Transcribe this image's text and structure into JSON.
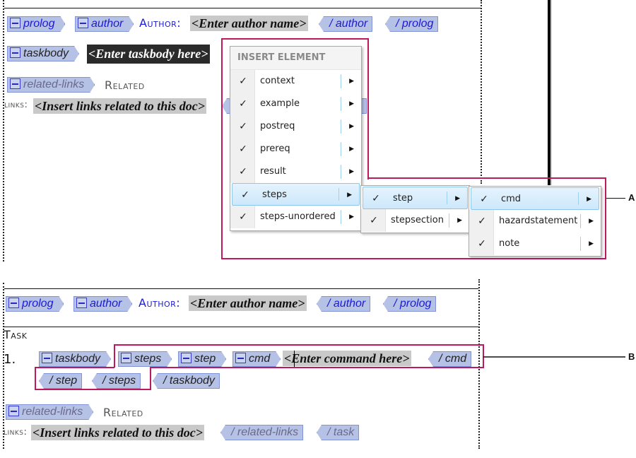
{
  "top_panel": {
    "row1": {
      "prolog_open": "prolog",
      "author_open": "author",
      "author_label": "Author:",
      "author_placeholder": "<Enter author name>",
      "author_close": "/ author",
      "prolog_close": "/ prolog"
    },
    "row2": {
      "taskbody_open": "taskbody",
      "taskbody_placeholder": "<Enter taskbody here>"
    },
    "row3": {
      "related_links_open": "related-links",
      "related_label_1": "Related",
      "related_label_2": "links:",
      "related_placeholder": "<Insert links related to this doc>"
    }
  },
  "insert_menu": {
    "title": "INSERT ELEMENT",
    "items": [
      {
        "label": "context",
        "checked": true,
        "has_submenu": true
      },
      {
        "label": "example",
        "checked": true,
        "has_submenu": true
      },
      {
        "label": "postreq",
        "checked": true,
        "has_submenu": true
      },
      {
        "label": "prereq",
        "checked": true,
        "has_submenu": true
      },
      {
        "label": "result",
        "checked": true,
        "has_submenu": true
      },
      {
        "label": "steps",
        "checked": true,
        "has_submenu": true,
        "highlighted": true
      },
      {
        "label": "steps-unordered",
        "checked": true,
        "has_submenu": true
      }
    ],
    "submenu_steps": [
      {
        "label": "step",
        "checked": true,
        "has_submenu": true,
        "highlighted": true
      },
      {
        "label": "stepsection",
        "checked": true,
        "has_submenu": true
      }
    ],
    "submenu_step": [
      {
        "label": "cmd",
        "checked": true,
        "has_submenu": true,
        "highlighted": true
      },
      {
        "label": "hazardstatement",
        "checked": true,
        "has_submenu": true
      },
      {
        "label": "note",
        "checked": true,
        "has_submenu": true
      }
    ],
    "check_glyph": "✓",
    "arrow_glyph": "▶"
  },
  "bottom_panel": {
    "row1": {
      "prolog_open": "prolog",
      "author_open": "author",
      "author_label": "Author:",
      "author_placeholder": "<Enter author name>",
      "author_close": "/ author",
      "prolog_close": "/ prolog"
    },
    "task_label": "Task",
    "list_number": "1.",
    "row2": {
      "taskbody_open": "taskbody",
      "steps_open": "steps",
      "step_open": "step",
      "cmd_open": "cmd",
      "cmd_placeholder": "<Enter command here>",
      "cmd_close": "/ cmd"
    },
    "row3": {
      "step_close": "/ step",
      "steps_close": "/ steps",
      "taskbody_close": "/ taskbody"
    },
    "row4": {
      "related_links_open": "related-links",
      "related_label_1": "Related",
      "related_label_2": "links:",
      "related_placeholder": "<Insert links related to this doc>",
      "related_links_close": "/ related-links",
      "task_close": "/ task"
    }
  },
  "callouts": {
    "a": "A",
    "b": "B"
  },
  "colors": {
    "callout": "#c0185f",
    "tag_fill": "#b6c1e6",
    "tag_text": "#1a1ad6",
    "menu_highlight": "#cde8fb"
  }
}
